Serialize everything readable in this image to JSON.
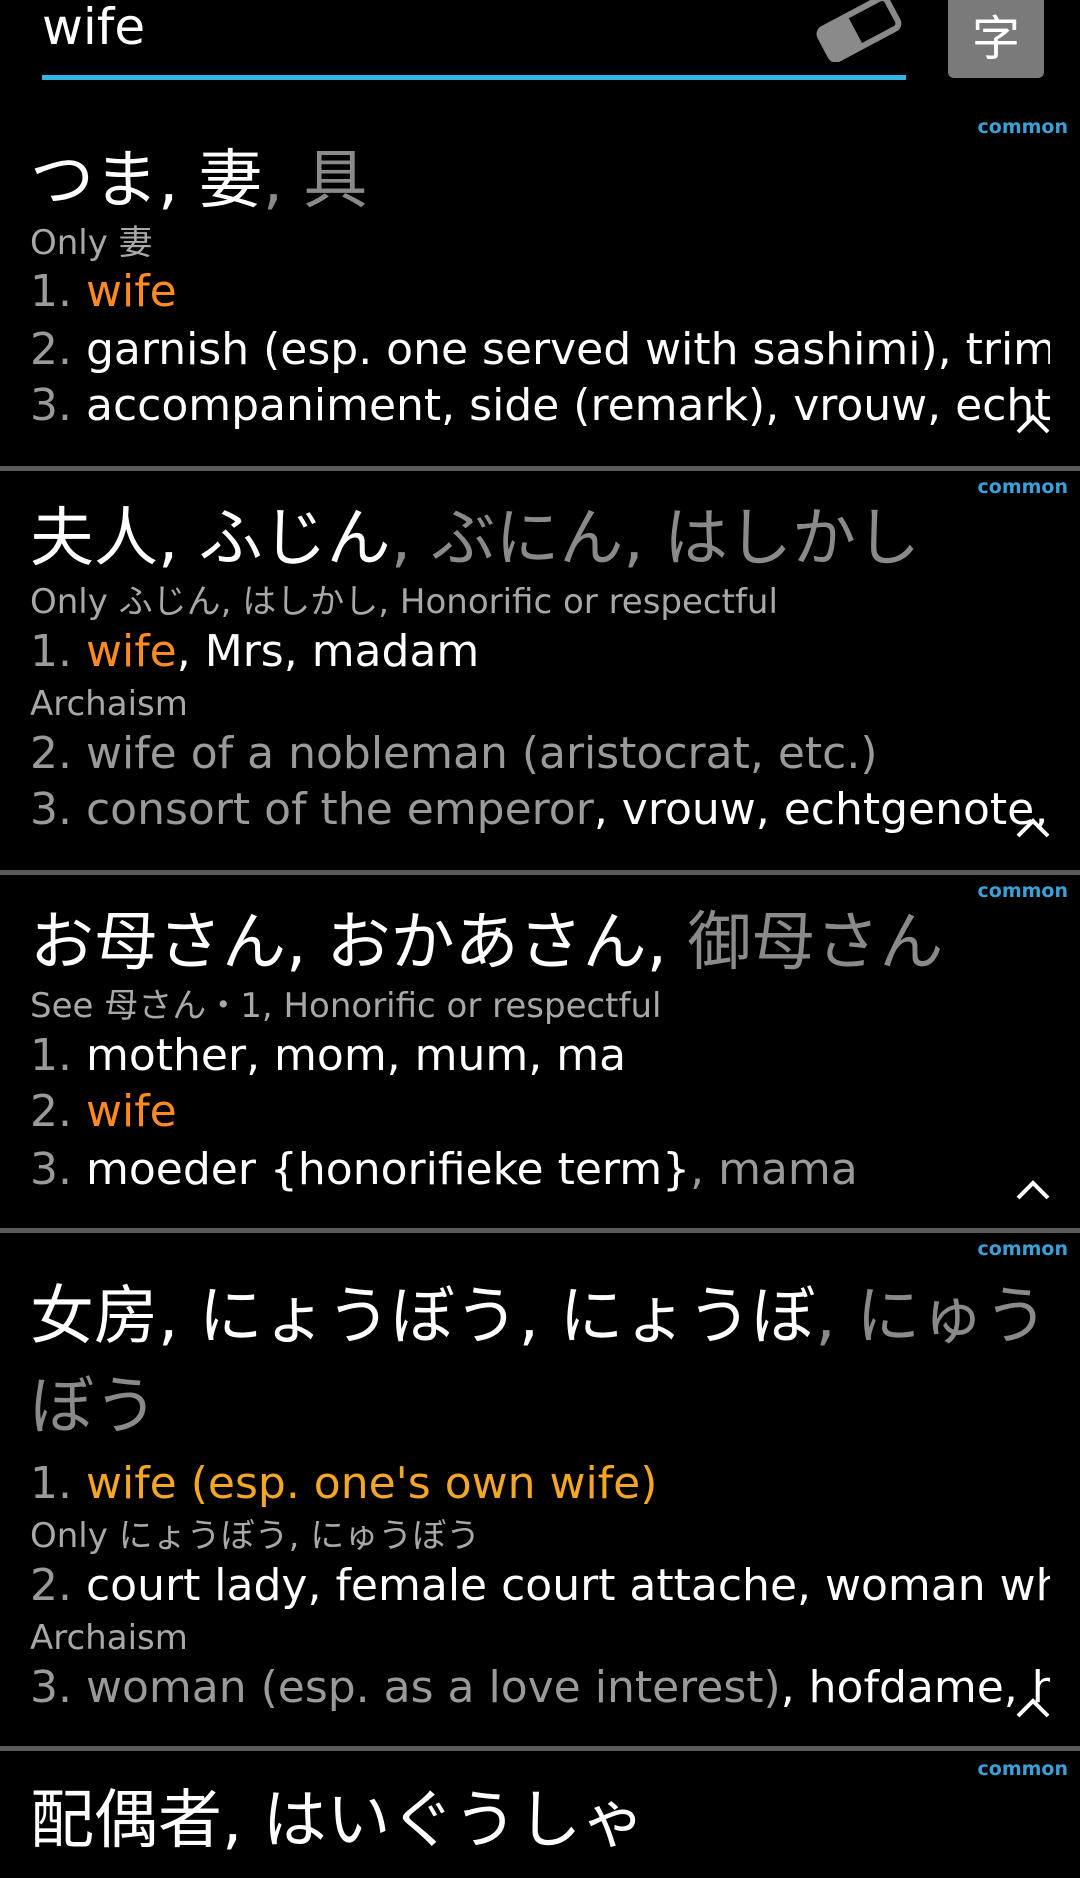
{
  "search": {
    "value": "wife",
    "kanji_button": "字"
  },
  "entries": [
    {
      "badge": "common",
      "headword": {
        "primary": "つま, 妻",
        "secondary": ", 具"
      },
      "note": "Only 妻",
      "senses": [
        {
          "num": "1.",
          "parts": [
            {
              "text": "wife",
              "style": "orange"
            }
          ]
        },
        {
          "num": "2.",
          "parts": [
            {
              "text": "garnish (esp. one served with sashimi), trim…",
              "style": "white"
            }
          ]
        },
        {
          "num": "3.",
          "parts": [
            {
              "text": "accompaniment, side (remark)",
              "style": "white"
            },
            {
              "text": ", vrouw, echtg",
              "style": "white"
            }
          ]
        }
      ]
    },
    {
      "badge": "common",
      "headword": {
        "primary": "夫人, ふじん",
        "secondary": ", ぶにん, はしかし"
      },
      "note": "Only ふじん, はしかし, Honorific or respectful",
      "senses": [
        {
          "num": "1.",
          "parts": [
            {
              "text": "wife",
              "style": "orange"
            },
            {
              "text": ", Mrs, madam",
              "style": "white"
            }
          ]
        },
        {
          "num": "2.",
          "parts": [
            {
              "text": "wife of a nobleman (aristocrat, etc.)",
              "style": "gray"
            }
          ]
        },
        {
          "num": "3.",
          "parts": [
            {
              "text": "consort of the emperor",
              "style": "gray"
            },
            {
              "text": ", vrouw, echtgenote, g",
              "style": "white"
            }
          ]
        }
      ],
      "archaism": "Archaism"
    },
    {
      "badge": "common",
      "headword": {
        "primary": "お母さん, おかあさん, ",
        "secondary": "御母さん"
      },
      "note": "See 母さん・1, Honorific or respectful",
      "senses": [
        {
          "num": "1.",
          "parts": [
            {
              "text": "mother, mom, mum, ma",
              "style": "white"
            }
          ]
        },
        {
          "num": "2.",
          "parts": [
            {
              "text": "wife",
              "style": "orange"
            }
          ]
        },
        {
          "num": "3.",
          "parts": [
            {
              "text": "moeder {honorifieke term}",
              "style": "white"
            },
            {
              "text": ", mama",
              "style": "gray"
            }
          ]
        }
      ]
    },
    {
      "badge": "common",
      "headword": {
        "primary": "女房, にょうぼう, にょうぼ",
        "secondary": ", にゅうぼう"
      },
      "note": "Only にょうぼう, にゅうぼう",
      "archaism": "Archaism",
      "senses": [
        {
          "num": "1.",
          "parts": [
            {
              "text": "wife (esp. one's own wife)",
              "style": "orange-soft"
            }
          ]
        },
        {
          "num": "2.",
          "parts": [
            {
              "text": "court lady, female court attache, woman wh…",
              "style": "white"
            }
          ]
        },
        {
          "num": "3.",
          "parts": [
            {
              "text": "woman (esp. as a love interest)",
              "style": "gray"
            },
            {
              "text": ", hofdame, h",
              "style": "white"
            }
          ]
        }
      ]
    },
    {
      "badge": "common",
      "headword": {
        "primary": "配偶者, はいぐうしゃ",
        "secondary": ""
      }
    }
  ]
}
